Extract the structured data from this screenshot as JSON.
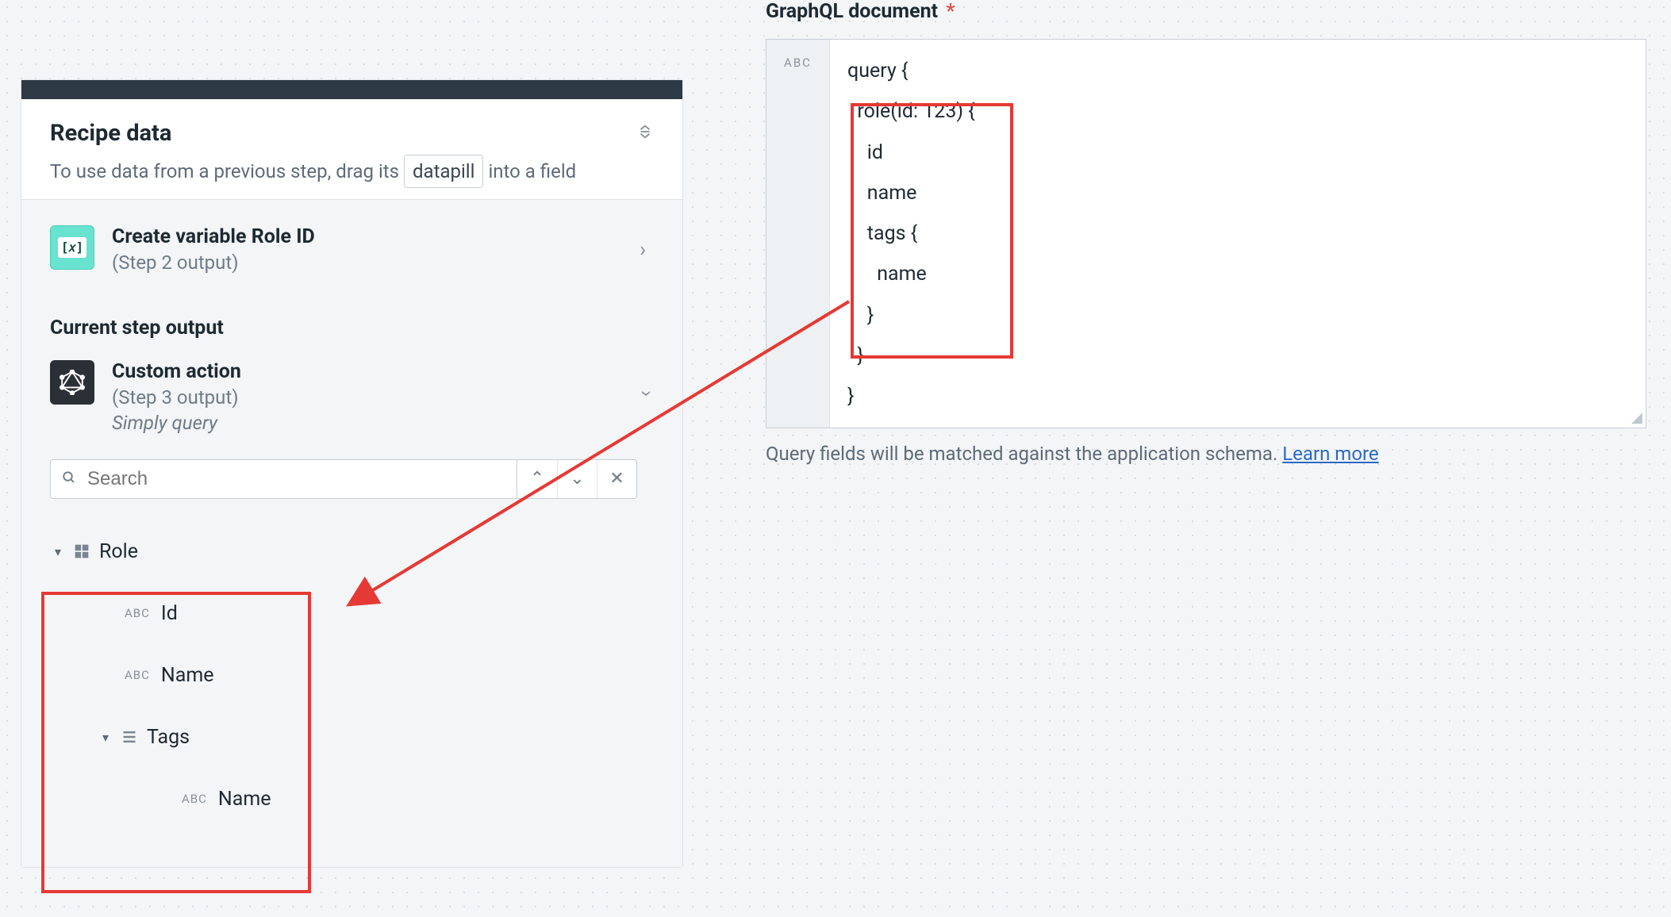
{
  "panel": {
    "title": "Recipe data",
    "subtitle_pre": "To use data from a previous step, drag its",
    "datapill_label": "datapill",
    "subtitle_post": "into a field"
  },
  "step_prev": {
    "title": "Create variable Role ID",
    "meta": "(Step 2 output)"
  },
  "current_label": "Current step output",
  "step_curr": {
    "title": "Custom action",
    "meta": "(Step 3 output)",
    "desc": "Simply query"
  },
  "search": {
    "placeholder": "Search"
  },
  "tree": {
    "root": "Role",
    "id": "Id",
    "name": "Name",
    "tags": "Tags",
    "tag_name": "Name",
    "abc": "ABC"
  },
  "right": {
    "label": "GraphQL document",
    "required": "*",
    "abc": "ABC",
    "code": "query {\n  role(id: 123) {\n    id\n    name\n    tags {\n      name\n    }\n  }\n}",
    "help_pre": "Query fields will be matched against the application schema.",
    "learn_more": "Learn more"
  }
}
